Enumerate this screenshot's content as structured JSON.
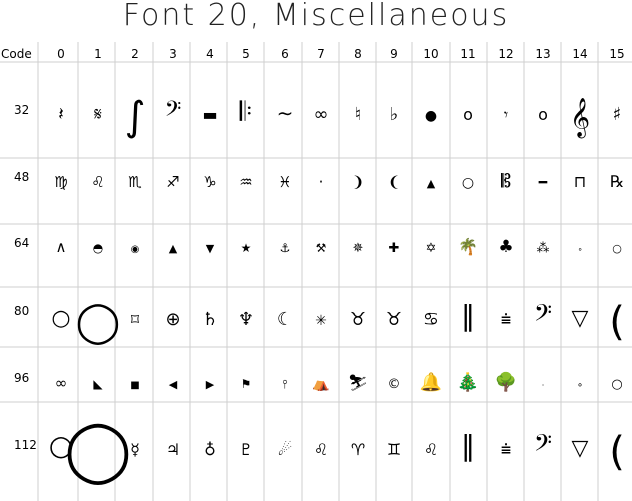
{
  "title": "Font 20, Miscellaneous",
  "code_header": "Code",
  "columns": [
    "0",
    "1",
    "2",
    "3",
    "4",
    "5",
    "6",
    "7",
    "8",
    "9",
    "10",
    "11",
    "12",
    "13",
    "14",
    "15"
  ],
  "rows": [
    {
      "code": "32",
      "glyphs": [
        "𝄽",
        "𝄋",
        "∫",
        "𝄢",
        "▬",
        "𝄆",
        "∼",
        "∞",
        "♮",
        "♭",
        "●",
        "o",
        "𝄾",
        "o",
        "𝄞",
        "♯"
      ]
    },
    {
      "code": "48",
      "glyphs": [
        "♍",
        "♌",
        "♏",
        "♐",
        "♑",
        "♒",
        "♓",
        "·",
        "❩",
        "❨",
        "▲",
        "○",
        "𝄡",
        "━",
        "⊓",
        "℞"
      ]
    },
    {
      "code": "64",
      "glyphs": [
        "∧",
        "◓",
        "◉",
        "▲",
        "▼",
        "★",
        "⚓",
        "⚒",
        "✵",
        "✚",
        "✡",
        "🌴",
        "♣",
        "⁂",
        "∘",
        "○"
      ]
    },
    {
      "code": "80",
      "glyphs": [
        "○",
        "◯",
        "⌑",
        "⊕",
        "♄",
        "♆",
        "☾",
        "✳",
        "♉",
        "♉",
        "♋",
        "‖",
        "⩧",
        "𝄢",
        "▽",
        "("
      ]
    },
    {
      "code": "96",
      "glyphs": [
        "∞",
        "◣",
        "■",
        "◀",
        "▶",
        "⚑",
        "⫯",
        "⛺",
        "⛷",
        "©",
        "🔔",
        "🎄",
        "🌳",
        "·",
        "∘",
        "○"
      ]
    },
    {
      "code": "112",
      "glyphs": [
        "○",
        "◯",
        "☿",
        "♃",
        "♁",
        "♇",
        "☄",
        "♌",
        "♈",
        "♊",
        "♌",
        "‖",
        "⩧",
        "𝄢",
        "▽",
        "("
      ]
    }
  ]
}
